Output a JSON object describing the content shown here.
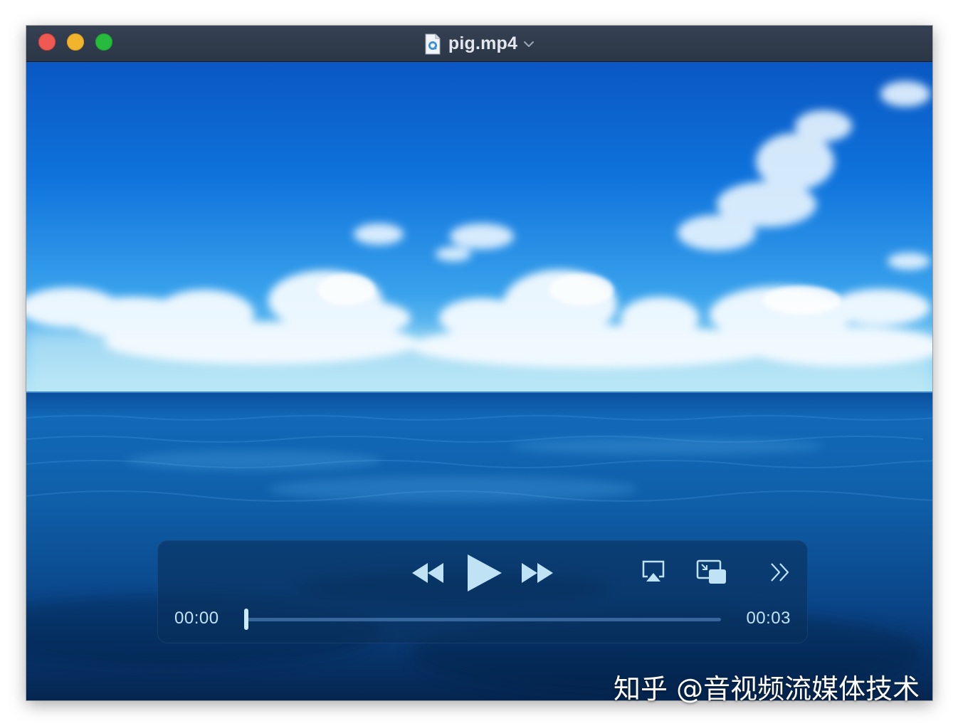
{
  "window": {
    "title": "pig.mp4",
    "file_icon": "quicktime-document-icon",
    "title_menu_icon": "chevron-down-icon"
  },
  "player": {
    "current_time": "00:00",
    "duration": "00:03",
    "progress_fraction": 0.0,
    "state": "paused",
    "buttons": [
      "rewind-icon",
      "play-icon",
      "fast-forward-icon",
      "airplay-icon",
      "picture-in-picture-icon",
      "more-chevrons-icon"
    ]
  },
  "watermark": "知乎 @音视频流媒体技术",
  "colors": {
    "titlebar": "#2f3a4a",
    "control_icons": "#bfe3f4",
    "close": "#ee5a52",
    "minimize": "#f0b42d",
    "maximize": "#26bb3d"
  }
}
